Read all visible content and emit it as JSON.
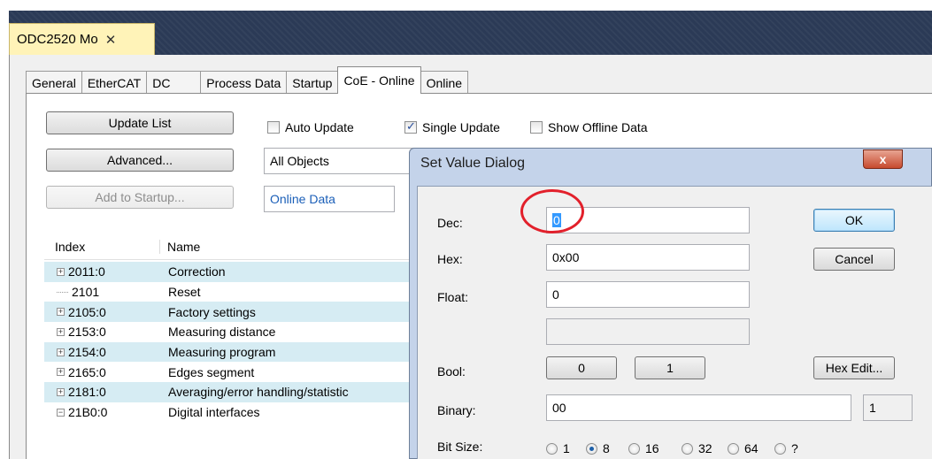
{
  "document_tab": {
    "label": "ODC2520 Mo",
    "close": "✕"
  },
  "tabs": [
    "General",
    "EtherCAT",
    "DC",
    "Process Data",
    "Startup",
    "CoE - Online",
    "Online"
  ],
  "buttons": {
    "update_list": "Update List",
    "advanced": "Advanced...",
    "add_to_startup": "Add to Startup..."
  },
  "checkboxes": {
    "auto_update": "Auto Update",
    "single_update": "Single Update",
    "show_offline": "Show Offline Data"
  },
  "fields": {
    "objects": "All Objects",
    "data_source": "Online Data"
  },
  "list": {
    "col_index": "Index",
    "col_name": "Name",
    "rows": [
      {
        "index": "2011:0",
        "name": "Correction",
        "expander": "+"
      },
      {
        "index": "2101",
        "name": "Reset",
        "expander": ""
      },
      {
        "index": "2105:0",
        "name": "Factory settings",
        "expander": "+"
      },
      {
        "index": "2153:0",
        "name": "Measuring distance",
        "expander": "+"
      },
      {
        "index": "2154:0",
        "name": "Measuring program",
        "expander": "+"
      },
      {
        "index": "2165:0",
        "name": "Edges segment",
        "expander": "+"
      },
      {
        "index": "2181:0",
        "name": "Averaging/error handling/statistic",
        "expander": "+"
      },
      {
        "index": "21B0:0",
        "name": "Digital interfaces",
        "expander": "−"
      }
    ]
  },
  "dialog": {
    "title": "Set Value Dialog",
    "close": "x",
    "labels": {
      "dec": "Dec:",
      "hex": "Hex:",
      "float": "Float:",
      "bool": "Bool:",
      "binary": "Binary:",
      "bit_size": "Bit Size:"
    },
    "values": {
      "dec": "0",
      "hex": "0x00",
      "float": "0",
      "binary": "00",
      "binary_count": "1"
    },
    "buttons": {
      "ok": "OK",
      "cancel": "Cancel",
      "bool_0": "0",
      "bool_1": "1",
      "hex_edit": "Hex Edit..."
    },
    "bit_sizes": [
      "1",
      "8",
      "16",
      "32",
      "64",
      "?"
    ],
    "selected_bit_size": "8"
  }
}
